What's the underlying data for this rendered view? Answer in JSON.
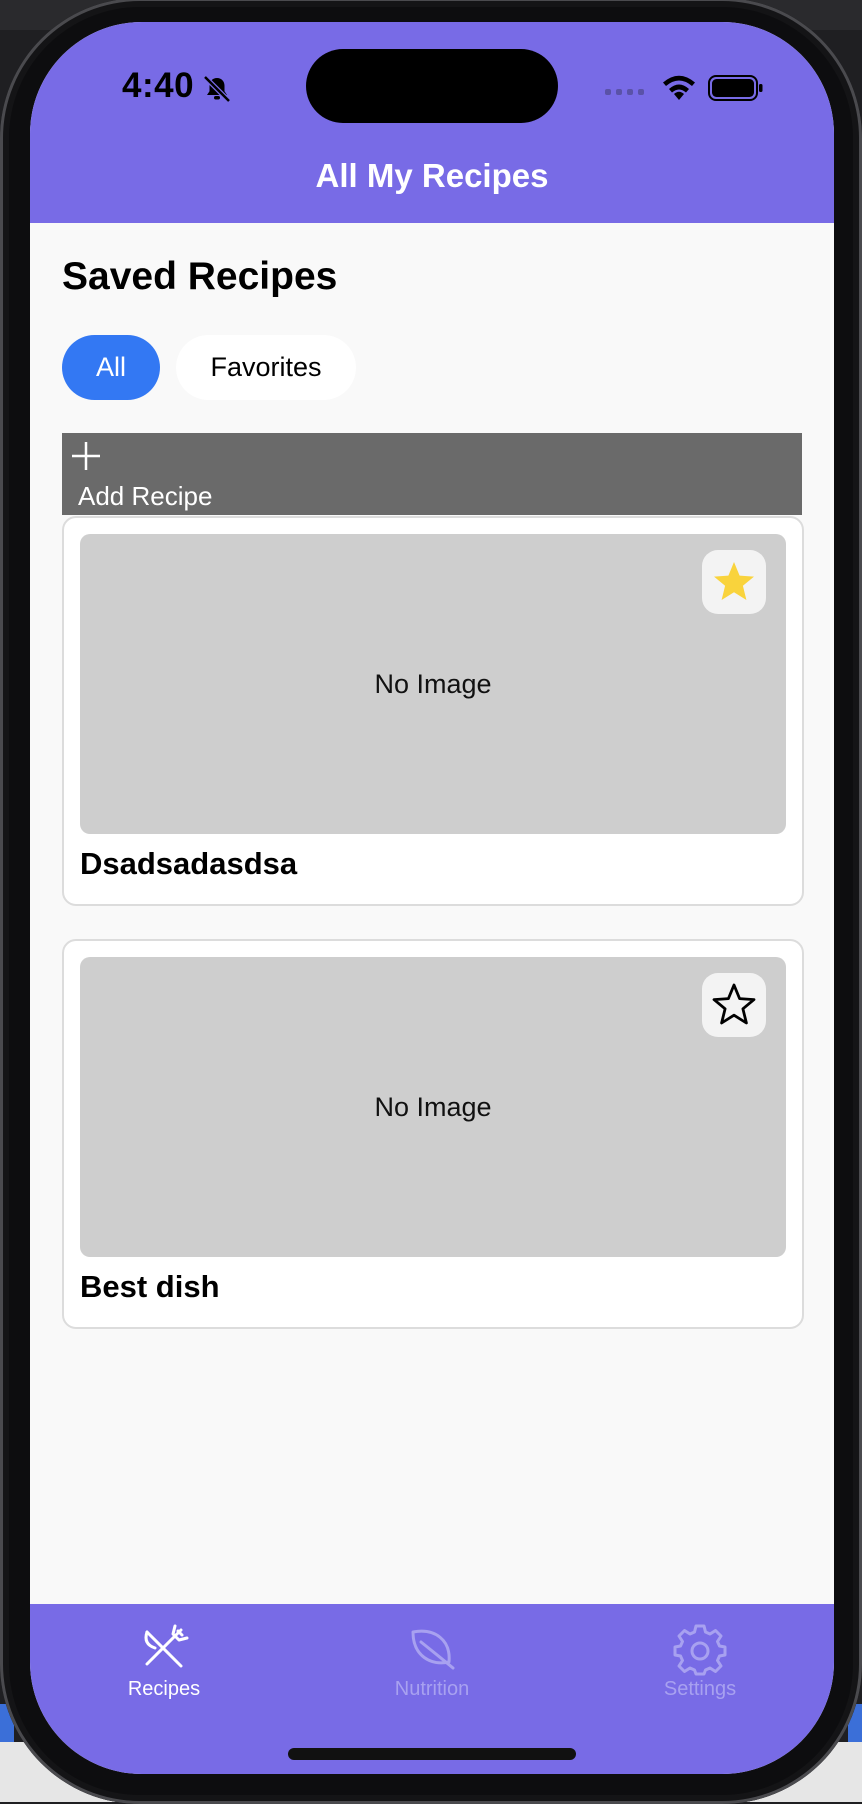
{
  "status_bar": {
    "time": "4:40"
  },
  "header": {
    "title": "All My Recipes"
  },
  "main": {
    "section_title": "Saved Recipes",
    "filters": [
      {
        "label": "All",
        "active": true
      },
      {
        "label": "Favorites",
        "active": false
      }
    ],
    "add_button": {
      "label": "Add Recipe"
    },
    "recipes": [
      {
        "title": "Dsadsadasdsa",
        "image_placeholder": "No Image",
        "favorite": true
      },
      {
        "title": "Best dish",
        "image_placeholder": "No Image",
        "favorite": false
      }
    ]
  },
  "tabbar": {
    "tabs": [
      {
        "label": "Recipes",
        "icon": "fork-knife-icon",
        "active": true
      },
      {
        "label": "Nutrition",
        "icon": "leaf-icon",
        "active": false
      },
      {
        "label": "Settings",
        "icon": "gear-icon",
        "active": false
      }
    ]
  },
  "colors": {
    "brand": "#786be6",
    "accent": "#3378f3",
    "favorite_star": "#f9d33c",
    "inactive_tab": "#a8a1f0"
  }
}
